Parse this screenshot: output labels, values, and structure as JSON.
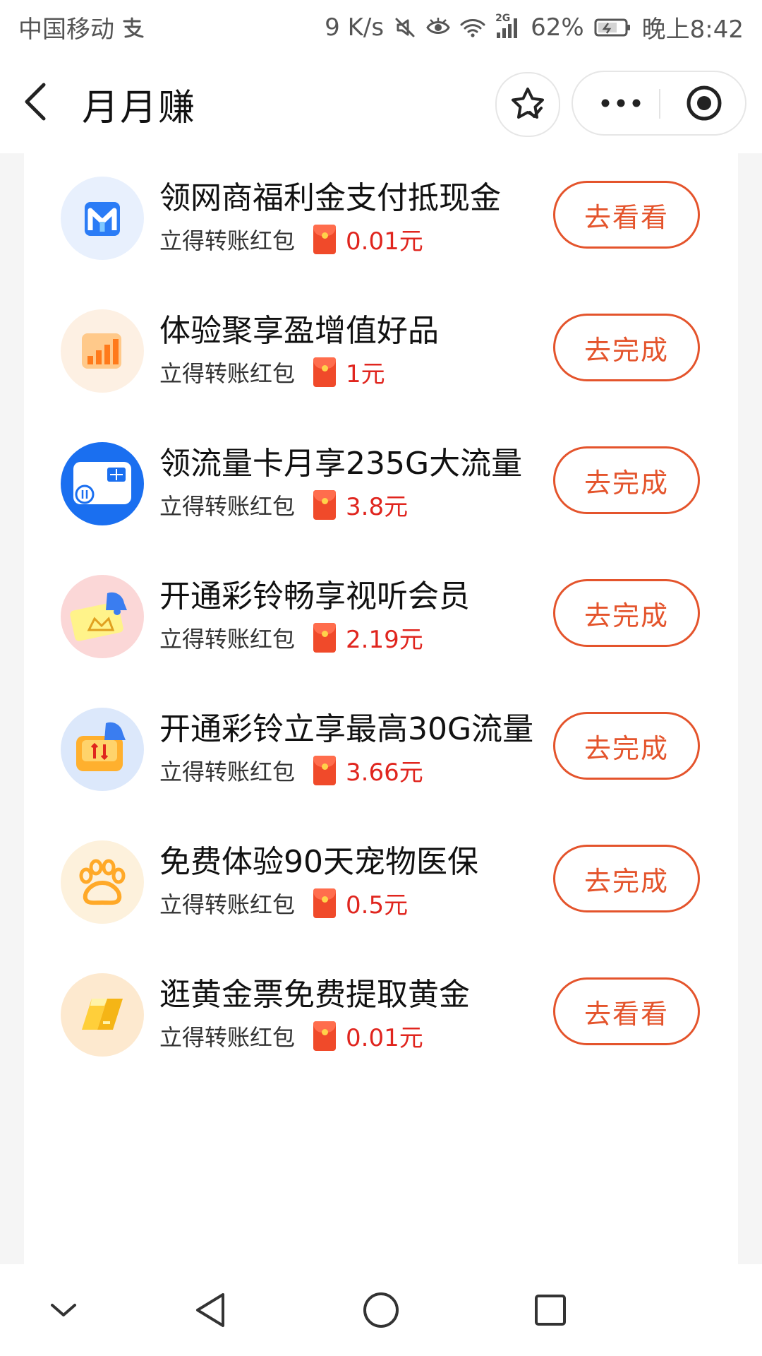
{
  "status_bar": {
    "carrier": "中国移动",
    "net_speed": "9 K/s",
    "battery": "62%",
    "time": "晚上8:42",
    "signal_type": "2G",
    "icons": [
      "alipay-icon",
      "mute-icon",
      "eye-icon",
      "wifi-icon",
      "signal-icon",
      "battery-icon"
    ]
  },
  "header": {
    "title": "月月赚",
    "icons": [
      "back-icon",
      "star-icon",
      "more-icon",
      "close-icon"
    ]
  },
  "tasks": [
    {
      "title": "领网商福利金支付抵现金",
      "subtitle": "立得转账红包",
      "reward": "0.01元",
      "button": "去看看",
      "icon": "mybank-icon",
      "icon_color": "#2b7cf6"
    },
    {
      "title": "体验聚享盈增值好品",
      "subtitle": "立得转账红包",
      "reward": "1元",
      "button": "去完成",
      "icon": "bar-chart-icon",
      "icon_color": "#ff8a2a"
    },
    {
      "title": "领流量卡月享235G大流量",
      "subtitle": "立得转账红包",
      "reward": "3.8元",
      "button": "去完成",
      "icon": "sim-card-icon",
      "icon_color": "#1a6ff0"
    },
    {
      "title": "开通彩铃畅享视听会员",
      "subtitle": "立得转账红包",
      "reward": "2.19元",
      "button": "去完成",
      "icon": "vip-ticket-icon",
      "icon_color": "#ff7070"
    },
    {
      "title": "开通彩铃立享最高30G流量",
      "subtitle": "立得转账红包",
      "reward": "3.66元",
      "button": "去完成",
      "icon": "data-traffic-icon",
      "icon_color": "#3a7df0"
    },
    {
      "title": "免费体验90天宠物医保",
      "subtitle": "立得转账红包",
      "reward": "0.5元",
      "button": "去完成",
      "icon": "paw-icon",
      "icon_color": "#ffb64a"
    },
    {
      "title": "逛黄金票免费提取黄金",
      "subtitle": "立得转账红包",
      "reward": "0.01元",
      "button": "去看看",
      "icon": "gold-bar-icon",
      "icon_color": "#f5b516"
    }
  ],
  "nav_bar": {
    "icons": [
      "collapse-icon",
      "nav-back-icon",
      "home-icon",
      "recents-icon"
    ]
  }
}
